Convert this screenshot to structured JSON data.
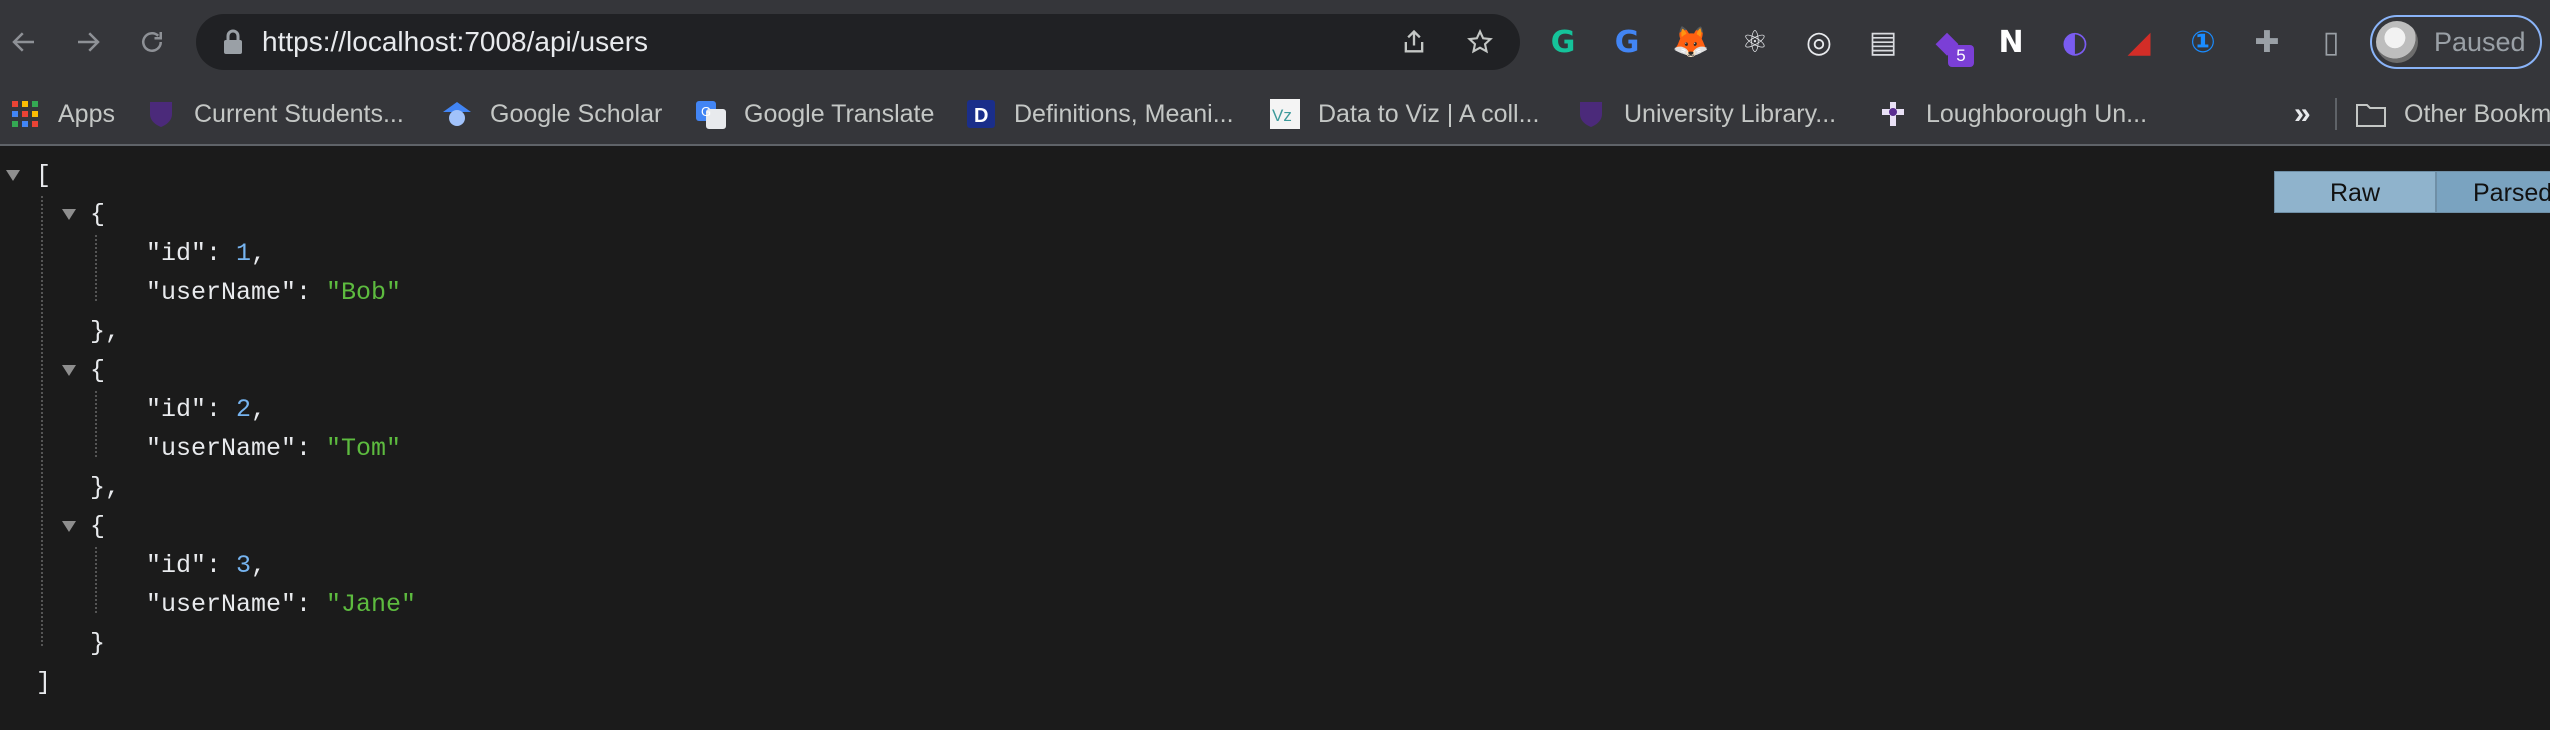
{
  "browser": {
    "url": "https://localhost:7008/api/users",
    "profile_label": "Paused",
    "extensions": [
      {
        "name": "grammarly-icon",
        "color": "#15c39a",
        "glyph": "G"
      },
      {
        "name": "google-translate-icon",
        "color": "#4285f4",
        "glyph": "G"
      },
      {
        "name": "metamask-icon",
        "color": "#e2761b",
        "glyph": "🦊"
      },
      {
        "name": "react-devtools-icon",
        "color": "#e8eaed",
        "glyph": "⚛"
      },
      {
        "name": "target-icon",
        "color": "#e8eaed",
        "glyph": "◎"
      },
      {
        "name": "document-icon",
        "color": "#dadce0",
        "glyph": "▤"
      },
      {
        "name": "extension-badge-icon",
        "color": "#7b3fd6",
        "glyph": "◆",
        "badge": "5"
      },
      {
        "name": "notion-icon",
        "color": "#ffffff",
        "glyph": "N"
      },
      {
        "name": "bing-chat-icon",
        "color": "#7a5cf0",
        "glyph": "◐"
      },
      {
        "name": "lastpass-icon",
        "color": "#d32d27",
        "glyph": "◢"
      },
      {
        "name": "1password-icon",
        "color": "#1a8cff",
        "glyph": "①"
      },
      {
        "name": "puzzle-icon",
        "color": "#9aa0a6",
        "glyph": "✚"
      },
      {
        "name": "side-panel-icon",
        "color": "#9aa0a6",
        "glyph": "▯"
      }
    ]
  },
  "bookmarks": [
    {
      "label": "Apps",
      "icon": "apps-grid-icon"
    },
    {
      "label": "Current Students...",
      "icon": "university-shield-icon"
    },
    {
      "label": "Google Scholar",
      "icon": "scholar-icon"
    },
    {
      "label": "Google Translate",
      "icon": "translate-icon"
    },
    {
      "label": "Definitions, Meani...",
      "icon": "dictionary-icon"
    },
    {
      "label": "Data to Viz | A coll...",
      "icon": "dataviz-icon"
    },
    {
      "label": "University Library...",
      "icon": "university-shield-icon"
    },
    {
      "label": "Loughborough Un...",
      "icon": "loughborough-icon"
    }
  ],
  "bookmarks_overflow": "»",
  "other_bookmarks": "Other Bookm",
  "viewer": {
    "raw_label": "Raw",
    "parsed_label": "Parsed",
    "open_bracket": "[",
    "close_bracket": "]",
    "users": [
      {
        "id": "1",
        "userName": "\"Bob\""
      },
      {
        "id": "2",
        "userName": "\"Tom\""
      },
      {
        "id": "3",
        "userName": "\"Jane\""
      }
    ]
  }
}
